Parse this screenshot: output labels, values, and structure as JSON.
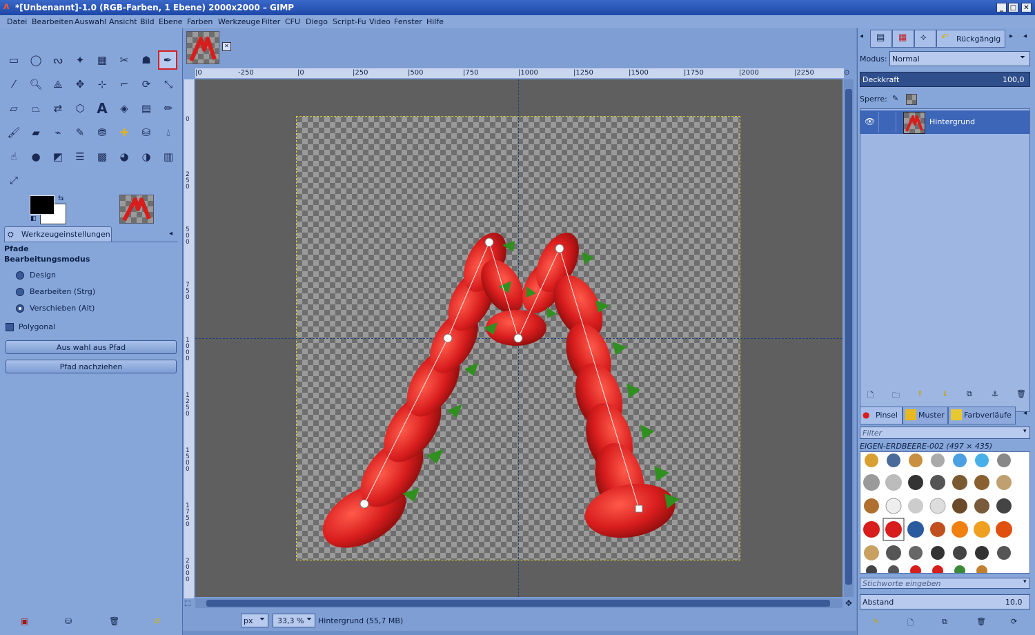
{
  "window": {
    "title": "*[Unbenannt]-1.0 (RGB-Farben, 1 Ebene) 2000x2000 – GIMP"
  },
  "menu": [
    "Datei",
    "Bearbeiten",
    "Auswahl",
    "Ansicht",
    "Bild",
    "Ebene",
    "Farben",
    "Werkzeuge",
    "Filter",
    "CFU",
    "Diego",
    "Script-Fu",
    "Video",
    "Fenster",
    "Hilfe"
  ],
  "toolbox": {
    "tab_label": "Werkzeugeinstellungen",
    "section": "Pfade",
    "mode_label": "Bearbeitungsmodus",
    "modes": [
      "Design",
      "Bearbeiten (Strg)",
      "Verschieben (Alt)"
    ],
    "selected_mode": "Verschieben (Alt)",
    "polygonal_label": "Polygonal",
    "btn_selection": "Aus wahl aus Pfad",
    "btn_stroke": "Pfad nachziehen"
  },
  "rulers": {
    "top": [
      "|0",
      "-250",
      "|0",
      "|250",
      "|500",
      "|750",
      "|1000",
      "|1250",
      "|1500",
      "|1750",
      "|2000",
      "|2250"
    ],
    "left": [
      "0",
      "2 5 0",
      "5 0 0",
      "7 5 0",
      "1 0 0 0",
      "1 2 5 0",
      "1 5 0 0",
      "1 7 5 0",
      "2 0 0 0"
    ]
  },
  "status": {
    "unit": "px",
    "zoom": "33,3 %",
    "info": "Hintergrund (55,7 MB)"
  },
  "dock": {
    "undo_label": "Rückgängig",
    "mode_label": "Modus:",
    "mode_value": "Normal",
    "opacity_label": "Deckkraft",
    "opacity_value": "100,0",
    "lock_label": "Sperre:",
    "layer_name": "Hintergrund",
    "tabs": [
      "Pinsel",
      "Muster",
      "Farbverläufe"
    ],
    "filter_placeholder": "Filter",
    "brush_name": "EIGEN-ERDBEERE-002 (497 × 435)",
    "tags_placeholder": "Stichworte eingeben",
    "spacing_label": "Abstand",
    "spacing_value": "10,0"
  },
  "colors": {
    "accent": "#86a6da",
    "title": "#1e48a8",
    "canvas_bg": "#5f5f5f",
    "strawberry": "#d81d1d",
    "leaf": "#2f8f1f"
  }
}
